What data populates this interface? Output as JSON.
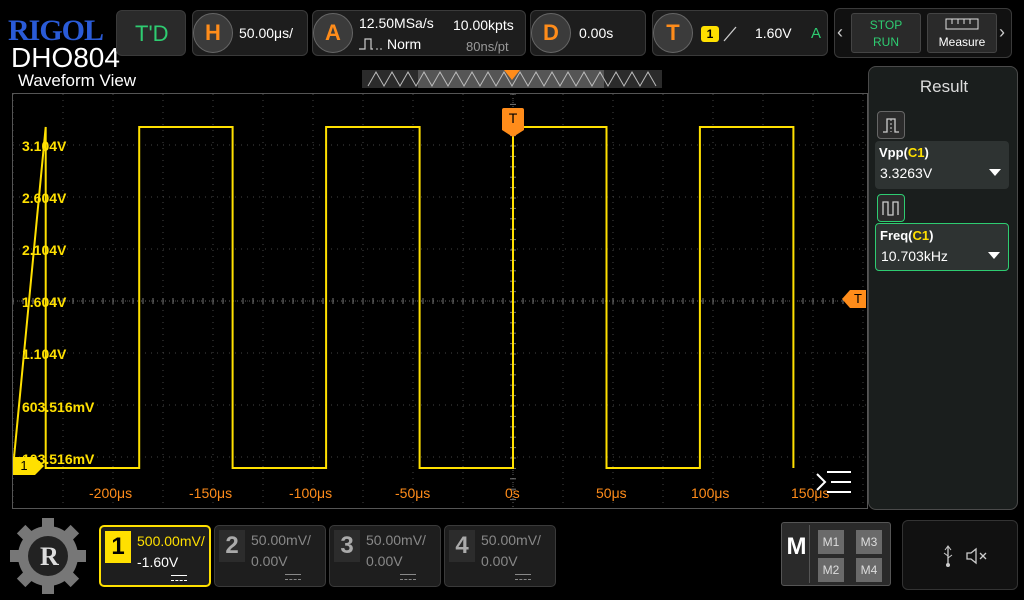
{
  "brand": "RIGOL",
  "model": "DHO804",
  "topbar": {
    "td_label": "T'D",
    "horizontal": {
      "key": "H",
      "timebase": "50.00μs/"
    },
    "acquire": {
      "key": "A",
      "sample_rate": "12.50MSa/s",
      "memory_depth": "10.00kpts",
      "mode": "Norm",
      "sample_interval": "80ns/pt"
    },
    "delay": {
      "key": "D",
      "value": "0.00s"
    },
    "trigger": {
      "key": "T",
      "source": "1",
      "level": "1.60V",
      "mode": "A"
    },
    "run_control": {
      "stop": "STOP",
      "run": "RUN"
    },
    "measure_label": "Measure"
  },
  "waveform_view": {
    "title": "Waveform View",
    "y_labels": [
      "3.104V",
      "2.604V",
      "2.104V",
      "1.604V",
      "1.104V",
      "603.516mV",
      "103.516mV"
    ],
    "x_labels": [
      "-200μs",
      "-150μs",
      "-100μs",
      "-50μs",
      "0s",
      "50μs",
      "100μs",
      "150μs",
      "200μs"
    ],
    "trigger_marker": "T",
    "channel_marker": "1"
  },
  "result_panel": {
    "title": "Result",
    "measurements": [
      {
        "name": "Vpp",
        "channel": "C1",
        "value": "3.3263V"
      },
      {
        "name": "Freq",
        "channel": "C1",
        "value": "10.703kHz"
      }
    ]
  },
  "channels": [
    {
      "num": "1",
      "scale": "500.00mV/",
      "offset": "-1.60V"
    },
    {
      "num": "2",
      "scale": "50.00mV/",
      "offset": "0.00V"
    },
    {
      "num": "3",
      "scale": "50.00mV/",
      "offset": "0.00V"
    },
    {
      "num": "4",
      "scale": "50.00mV/",
      "offset": "0.00V"
    }
  ],
  "math": {
    "key": "M",
    "items": [
      "M1",
      "M3",
      "M2",
      "M4"
    ]
  },
  "colors": {
    "ch1": "#ffe000",
    "trigger": "#ff8c1a",
    "run_stop": "#2ecc71",
    "brand": "#2a5bd7"
  }
}
